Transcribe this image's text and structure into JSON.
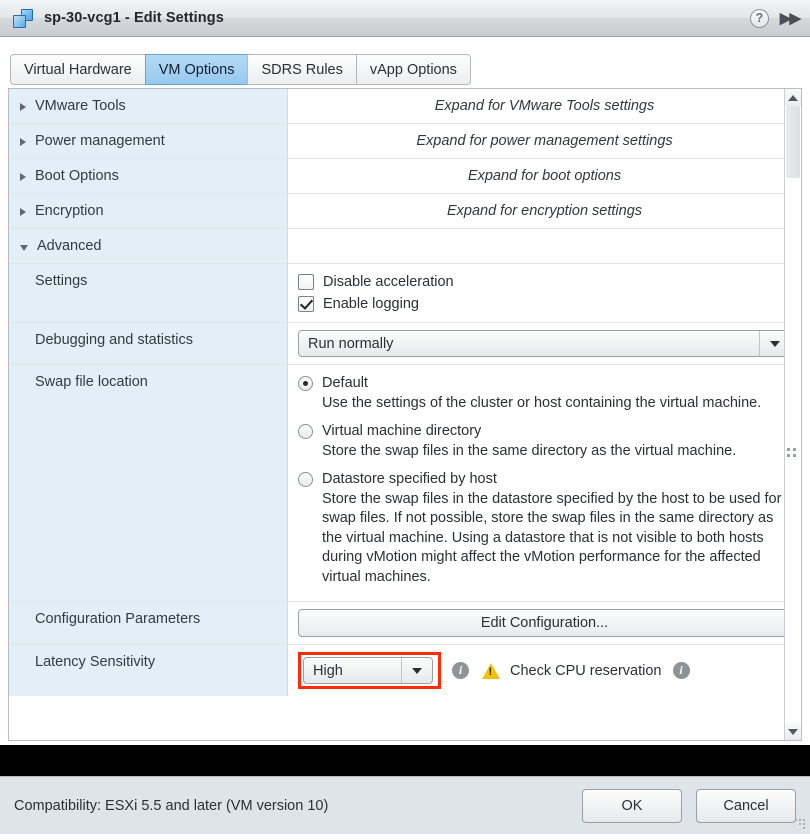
{
  "titlebar": {
    "vm_icon": "virtual-machine-icon",
    "title": "sp-30-vcg1 - Edit Settings",
    "help_label": "?",
    "expand_label": "▶▶"
  },
  "tabs": [
    {
      "label": "Virtual Hardware",
      "active": false
    },
    {
      "label": "VM Options",
      "active": true
    },
    {
      "label": "SDRS Rules",
      "active": false
    },
    {
      "label": "vApp Options",
      "active": false
    }
  ],
  "sections": {
    "vmware_tools": {
      "label": "VMware Tools",
      "hint": "Expand for VMware Tools settings",
      "expanded": false
    },
    "power_management": {
      "label": "Power management",
      "hint": "Expand for power management settings",
      "expanded": false
    },
    "boot_options": {
      "label": "Boot Options",
      "hint": "Expand for boot options",
      "expanded": false
    },
    "encryption": {
      "label": "Encryption",
      "hint": "Expand for encryption settings",
      "expanded": false
    },
    "advanced": {
      "label": "Advanced",
      "expanded": true
    }
  },
  "advanced": {
    "settings": {
      "label": "Settings",
      "disable_acceleration": {
        "label": "Disable acceleration",
        "checked": false
      },
      "enable_logging": {
        "label": "Enable logging",
        "checked": true
      }
    },
    "debugging": {
      "label": "Debugging and statistics",
      "value": "Run normally"
    },
    "swap_file_location": {
      "label": "Swap file location",
      "options": [
        {
          "title": "Default",
          "description": "Use the settings of the cluster or host containing the virtual machine.",
          "selected": true
        },
        {
          "title": "Virtual machine directory",
          "description": "Store the swap files in the same directory as the virtual machine.",
          "selected": false
        },
        {
          "title": "Datastore specified by host",
          "description": "Store the swap files in the datastore specified by the host to be used for swap files. If not possible, store the swap files in the same directory as the virtual machine. Using a datastore that is not visible to both hosts during vMotion might affect the vMotion performance for the affected virtual machines.",
          "selected": false
        }
      ]
    },
    "configuration_parameters": {
      "label": "Configuration Parameters",
      "button_label": "Edit Configuration..."
    },
    "latency_sensitivity": {
      "label": "Latency Sensitivity",
      "value": "High",
      "info_label": "i",
      "warning_label": "!",
      "warning_text": "Check CPU reservation",
      "trailing_info_label": "i",
      "highlight_color": "#fb2d09"
    }
  },
  "footer": {
    "compatibility": "Compatibility: ESXi 5.5 and later (VM version 10)",
    "ok_label": "OK",
    "cancel_label": "Cancel"
  },
  "scrollbar": {
    "up_arrow": "scroll-up-arrow",
    "down_arrow": "scroll-down-arrow"
  }
}
